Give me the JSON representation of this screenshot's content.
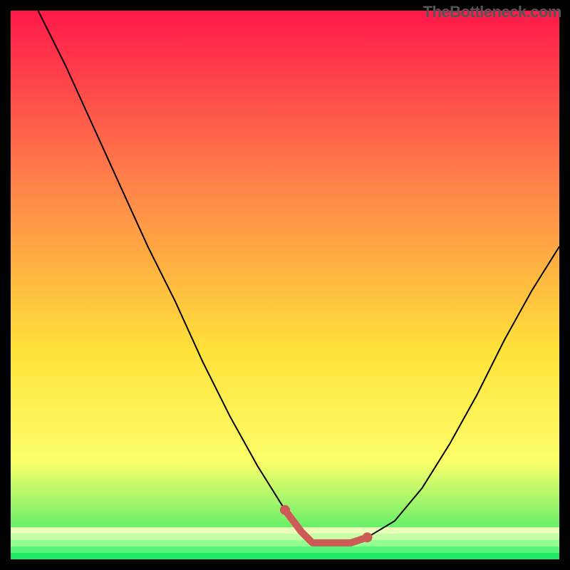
{
  "watermark": "TheBottleneck.com",
  "chart_data": {
    "type": "line",
    "title": "",
    "xlabel": "",
    "ylabel": "",
    "xlim": [
      0,
      100
    ],
    "ylim": [
      0,
      100
    ],
    "series": [
      {
        "name": "curve",
        "x": [
          5,
          10,
          15,
          20,
          25,
          30,
          35,
          40,
          45,
          50,
          53,
          55,
          57,
          60,
          65,
          70,
          75,
          80,
          85,
          90,
          95,
          100
        ],
        "values": [
          100,
          90,
          79,
          68,
          57,
          47,
          36,
          26,
          17,
          9,
          5,
          3,
          3,
          3,
          4,
          7,
          13,
          21,
          30,
          40,
          49,
          57
        ]
      }
    ],
    "marked_segment": {
      "name": "highlight",
      "color": "#cc5a56",
      "x": [
        50,
        53,
        55,
        57,
        60,
        62,
        65
      ],
      "values": [
        9,
        5,
        3,
        3,
        3,
        3,
        4
      ]
    },
    "gradient": {
      "top": "#ff194a",
      "mid1": "#ff8449",
      "mid2": "#ffe23a",
      "mid3": "#fdff6a",
      "bottom": "#22e86a",
      "base_stripes": [
        "#e9ffb8",
        "#c6ffa6",
        "#93ff8e",
        "#57f579",
        "#22e86a"
      ]
    }
  }
}
